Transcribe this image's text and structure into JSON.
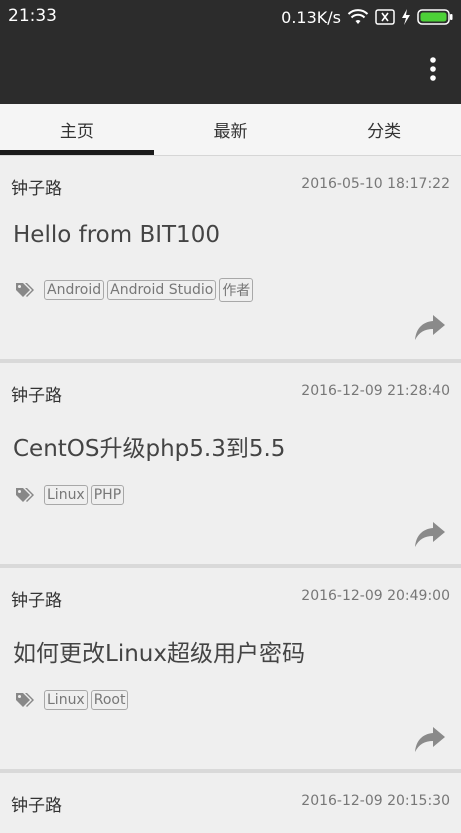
{
  "status_bar": {
    "time": "21:33",
    "speed": "0.13K/s",
    "icons": [
      "wifi-icon",
      "no-sim-icon",
      "charging-bolt-icon",
      "battery-icon"
    ]
  },
  "app_bar": {
    "menu_icon": "more-vert-icon",
    "background": "#2c2c2c"
  },
  "tabs": [
    {
      "label": "主页",
      "active": true
    },
    {
      "label": "最新",
      "active": false
    },
    {
      "label": "分类",
      "active": false
    }
  ],
  "posts": [
    {
      "author": "钟子路",
      "date": "2016-05-10 18:17:22",
      "title": "Hello from BIT100",
      "tags": [
        "Android",
        "Android Studio",
        "作者"
      ]
    },
    {
      "author": "钟子路",
      "date": "2016-12-09 21:28:40",
      "title": "CentOS升级php5.3到5.5",
      "tags": [
        "Linux",
        "PHP"
      ]
    },
    {
      "author": "钟子路",
      "date": "2016-12-09 20:49:00",
      "title": "如何更改Linux超级用户密码",
      "tags": [
        "Linux",
        "Root"
      ]
    },
    {
      "author": "钟子路",
      "date": "2016-12-09 20:15:30",
      "title": "",
      "tags": []
    }
  ],
  "colors": {
    "status_bar": "#2c2c2c",
    "card_bg": "#efefef",
    "battery": "#4cd137"
  }
}
